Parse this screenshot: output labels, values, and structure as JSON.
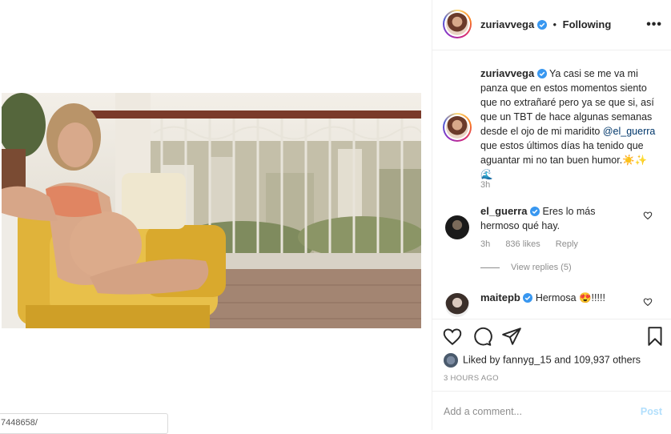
{
  "url_fragment": "7448658/",
  "header": {
    "username": "zuriavvega",
    "separator": "•",
    "follow_status": "Following",
    "more_label": "•••"
  },
  "caption": {
    "username": "zuriavvega",
    "text_before": "Ya casi se me va mi panza que en estos momentos siento que no extrañaré pero ya se que si, así que un TBT de hace algunas semanas desde el ojo de mi maridito ",
    "mention": "@el_guerra",
    "text_after": " que estos últimos días ha tenido que aguantar mi no tan buen humor.☀️✨🌊",
    "time": "3h"
  },
  "comments": [
    {
      "username": "el_guerra",
      "text": "Eres lo más hermoso qué hay.",
      "time": "3h",
      "likes": "836 likes",
      "reply": "Reply",
      "view_replies": "View replies (5)"
    },
    {
      "username": "maitepb",
      "text": "Hermosa 😍!!!!!"
    }
  ],
  "likes": {
    "prefix": "Liked by ",
    "user": "fannyg_15",
    "middle": " and ",
    "count": "109,937 others"
  },
  "time_ago": "3 HOURS AGO",
  "comment_box": {
    "placeholder": "Add a comment...",
    "post_label": "Post"
  },
  "colors": {
    "verified": "#3897f0",
    "link": "#00376b",
    "muted": "#8e8e8e",
    "post_disabled": "#b2dffc"
  }
}
